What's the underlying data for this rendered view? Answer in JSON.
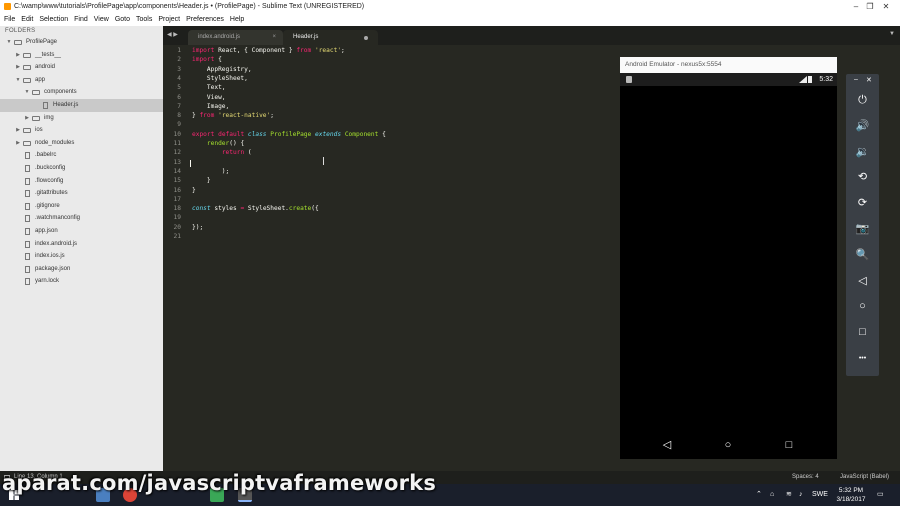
{
  "window": {
    "title": "C:\\wamp\\www\\tutorials\\ProfilePage\\app\\components\\Header.js • (ProfilePage) - Sublime Text (UNREGISTERED)",
    "controls": {
      "minimize": "–",
      "maximize": "❐",
      "close": "✕"
    }
  },
  "menu": [
    "File",
    "Edit",
    "Selection",
    "Find",
    "View",
    "Goto",
    "Tools",
    "Project",
    "Preferences",
    "Help"
  ],
  "sidebar": {
    "header": "FOLDERS",
    "items": [
      {
        "label": "ProfilePage",
        "type": "folder",
        "depth": 0,
        "open": true
      },
      {
        "label": "__tests__",
        "type": "folder",
        "depth": 1,
        "open": false
      },
      {
        "label": "android",
        "type": "folder",
        "depth": 1,
        "open": false
      },
      {
        "label": "app",
        "type": "folder",
        "depth": 1,
        "open": true
      },
      {
        "label": "components",
        "type": "folder",
        "depth": 2,
        "open": true
      },
      {
        "label": "Header.js",
        "type": "file",
        "depth": 3,
        "active": true
      },
      {
        "label": "img",
        "type": "folder",
        "depth": 2,
        "open": false
      },
      {
        "label": "ios",
        "type": "folder",
        "depth": 1,
        "open": false
      },
      {
        "label": "node_modules",
        "type": "folder",
        "depth": 1,
        "open": false
      },
      {
        "label": ".babelrc",
        "type": "file",
        "depth": 1
      },
      {
        "label": ".buckconfig",
        "type": "file",
        "depth": 1
      },
      {
        "label": ".flowconfig",
        "type": "file",
        "depth": 1
      },
      {
        "label": ".gitattributes",
        "type": "file",
        "depth": 1
      },
      {
        "label": ".gitignore",
        "type": "file",
        "depth": 1
      },
      {
        "label": ".watchmanconfig",
        "type": "file",
        "depth": 1
      },
      {
        "label": "app.json",
        "type": "file",
        "depth": 1
      },
      {
        "label": "index.android.js",
        "type": "file",
        "depth": 1
      },
      {
        "label": "index.ios.js",
        "type": "file",
        "depth": 1
      },
      {
        "label": "package.json",
        "type": "file",
        "depth": 1
      },
      {
        "label": "yarn.lock",
        "type": "file",
        "depth": 1
      }
    ]
  },
  "tabs": [
    {
      "label": "index.android.js",
      "active": false,
      "marker": "×"
    },
    {
      "label": "Header.js",
      "active": true,
      "marker": "dirty"
    }
  ],
  "tab_nav": {
    "left": "◀ ▶",
    "right": "▼"
  },
  "editor": {
    "lines": [
      [
        [
          "k",
          "import"
        ],
        [
          "p",
          " React, { Component } "
        ],
        [
          "k",
          "from"
        ],
        [
          "p",
          " "
        ],
        [
          "s",
          "'react'"
        ],
        [
          "p",
          ";"
        ]
      ],
      [
        [
          "k",
          "import"
        ],
        [
          "p",
          " {"
        ]
      ],
      [
        [
          "p",
          "    AppRegistry,"
        ]
      ],
      [
        [
          "p",
          "    StyleSheet,"
        ]
      ],
      [
        [
          "p",
          "    Text,"
        ]
      ],
      [
        [
          "p",
          "    View,"
        ]
      ],
      [
        [
          "p",
          "    Image,"
        ]
      ],
      [
        [
          "p",
          "} "
        ],
        [
          "k",
          "from"
        ],
        [
          "p",
          " "
        ],
        [
          "s",
          "'react-native'"
        ],
        [
          "p",
          ";"
        ]
      ],
      [
        [
          "p",
          ""
        ]
      ],
      [
        [
          "k",
          "export"
        ],
        [
          "p",
          " "
        ],
        [
          "k",
          "default"
        ],
        [
          "p",
          " "
        ],
        [
          "c",
          "class"
        ],
        [
          "p",
          " "
        ],
        [
          "n",
          "ProfilePage"
        ],
        [
          "p",
          " "
        ],
        [
          "c",
          "extends"
        ],
        [
          "p",
          " "
        ],
        [
          "n",
          "Component"
        ],
        [
          "p",
          " {"
        ]
      ],
      [
        [
          "p",
          "    "
        ],
        [
          "n",
          "render"
        ],
        [
          "p",
          "() {"
        ]
      ],
      [
        [
          "p",
          "        "
        ],
        [
          "k",
          "return"
        ],
        [
          "p",
          " ("
        ]
      ],
      [
        [
          "p",
          ""
        ]
      ],
      [
        [
          "p",
          "        );"
        ]
      ],
      [
        [
          "p",
          "    }"
        ]
      ],
      [
        [
          "p",
          "}"
        ]
      ],
      [
        [
          "p",
          ""
        ]
      ],
      [
        [
          "c",
          "const"
        ],
        [
          "p",
          " styles "
        ],
        [
          "k",
          "="
        ],
        [
          "p",
          " StyleSheet."
        ],
        [
          "n",
          "create"
        ],
        [
          "p",
          "({"
        ]
      ],
      [
        [
          "p",
          ""
        ]
      ],
      [
        [
          "p",
          "});"
        ]
      ],
      [
        [
          "p",
          ""
        ]
      ]
    ]
  },
  "emulator": {
    "title": "Android Emulator - nexus5x:5554",
    "time": "5:32",
    "nav": {
      "back": "◁",
      "home": "○",
      "recents": "□"
    },
    "panel_controls": {
      "minimize": "–",
      "close": "✕"
    },
    "tools": [
      {
        "name": "power-icon",
        "glyph": "⏻"
      },
      {
        "name": "volume-up-icon",
        "glyph": "🔊"
      },
      {
        "name": "volume-down-icon",
        "glyph": "🔉"
      },
      {
        "name": "rotate-left-icon",
        "glyph": "⟲"
      },
      {
        "name": "rotate-right-icon",
        "glyph": "⟳"
      },
      {
        "name": "camera-icon",
        "glyph": "📷"
      },
      {
        "name": "zoom-icon",
        "glyph": "🔍"
      },
      {
        "name": "back-icon",
        "glyph": "◁"
      },
      {
        "name": "home-icon",
        "glyph": "○"
      },
      {
        "name": "overview-icon",
        "glyph": "□"
      },
      {
        "name": "more-icon",
        "glyph": "•••"
      }
    ]
  },
  "statusbar": {
    "position": "Line 13, Column 1",
    "spaces": "Spaces: 4",
    "syntax": "JavaScript (Babel)"
  },
  "watermark": "aparat.com/javascriptvaframeworks",
  "taskbar": {
    "language": "SWE",
    "time": "5:32 PM",
    "date": "3/18/2017"
  }
}
